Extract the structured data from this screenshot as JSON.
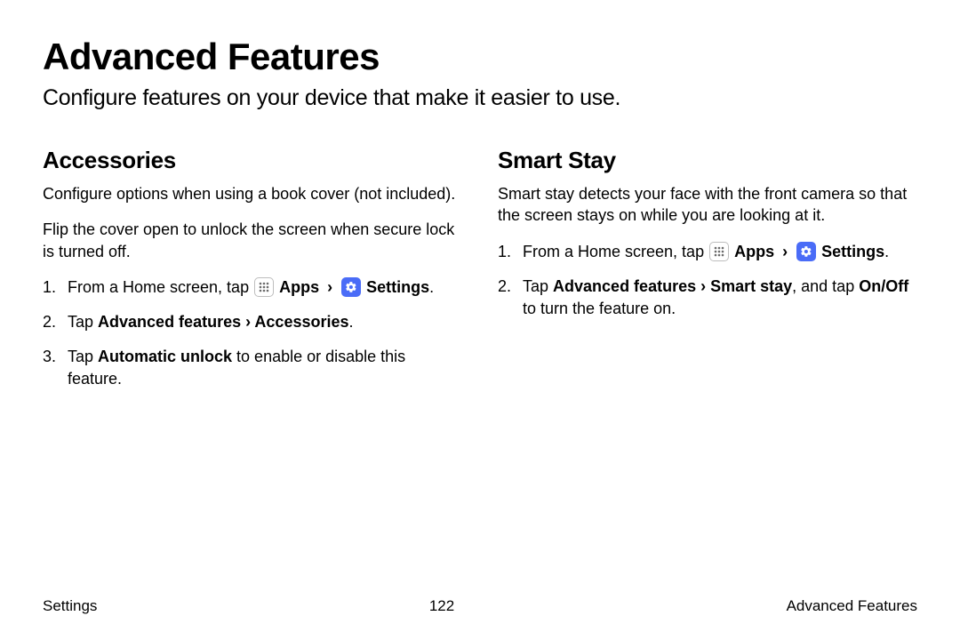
{
  "page": {
    "title": "Advanced Features",
    "subtitle": "Configure features on your device that make it easier to use."
  },
  "columns": {
    "left": {
      "heading": "Accessories",
      "desc1": "Configure options when using a book cover (not included).",
      "desc2": "Flip the cover open to unlock the screen when secure lock is turned off.",
      "step1_prefix": "From a Home screen, tap ",
      "step1_apps": "Apps",
      "step1_chevron": "›",
      "step1_settings": "Settings",
      "step1_suffix": ".",
      "step2_prefix": "Tap ",
      "step2_bold": "Advanced features › Accessories",
      "step2_suffix": ".",
      "step3_prefix": "Tap ",
      "step3_bold": "Automatic unlock",
      "step3_suffix": " to enable or disable this feature."
    },
    "right": {
      "heading": "Smart Stay",
      "desc1": "Smart stay detects your face with the front camera so that the screen stays on while you are looking at it.",
      "step1_prefix": "From a Home screen, tap ",
      "step1_apps": "Apps",
      "step1_chevron": "›",
      "step1_settings": "Settings",
      "step1_suffix": ".",
      "step2_prefix": "Tap ",
      "step2_bold1": "Advanced features › Smart stay",
      "step2_mid": ", and tap ",
      "step2_bold2": "On/Off",
      "step2_suffix": " to turn the feature on."
    }
  },
  "footer": {
    "left": "Settings",
    "center": "122",
    "right": "Advanced Features"
  },
  "icons": {
    "apps_name": "apps-icon",
    "settings_name": "settings-icon"
  }
}
